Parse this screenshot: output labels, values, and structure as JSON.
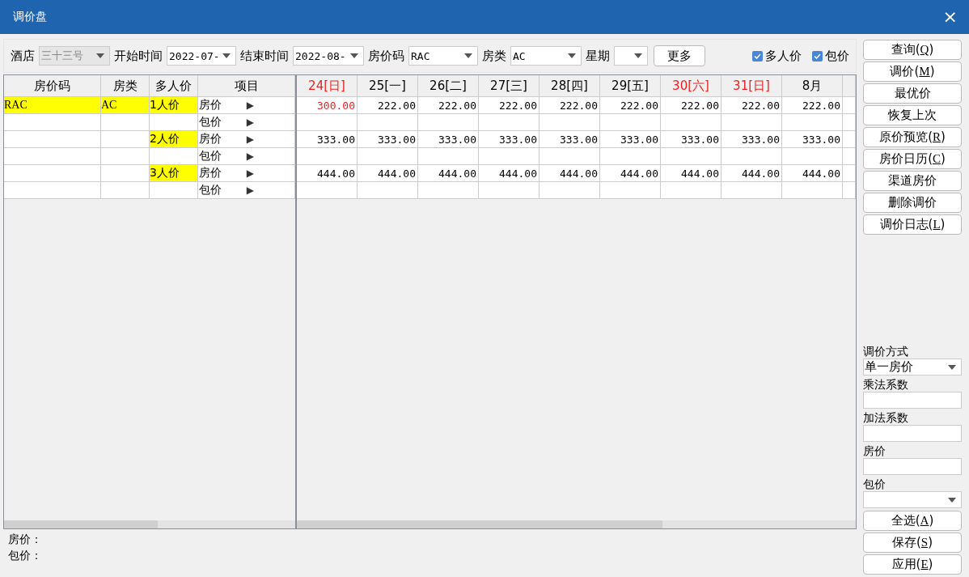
{
  "window": {
    "title": "调价盘",
    "close": "×"
  },
  "filters": [
    {
      "label": "酒店",
      "value": "三十三号",
      "disabled": true
    },
    {
      "label": "开始时间",
      "value": "2022-07-",
      "disabled": false
    },
    {
      "label": "结束时间",
      "value": "2022-08-",
      "disabled": false
    },
    {
      "label": "房价码",
      "value": "RAC",
      "disabled": false
    },
    {
      "label": "房类",
      "value": "AC",
      "disabled": false
    },
    {
      "label": "星期",
      "disabled": false
    }
  ],
  "more_button": "更多",
  "checkboxes": [
    {
      "label": "多人价",
      "checked": true
    },
    {
      "label": "包价",
      "checked": true
    }
  ],
  "left_table": {
    "columns": [
      "房价码",
      "房类",
      "多人价",
      "项目"
    ],
    "rows": [
      {
        "rate_code": "RAC",
        "room_type": "AC",
        "multi": "1人价",
        "item": "房价",
        "arrow": "▶"
      },
      {
        "item": "包价",
        "arrow": "▶"
      },
      {
        "multi": "2人价",
        "item": "房价",
        "arrow": "▶"
      },
      {
        "item": "包价",
        "arrow": "▶"
      },
      {
        "multi": "3人价",
        "item": "房价",
        "arrow": "▶"
      },
      {
        "item": "包价",
        "arrow": "▶"
      }
    ]
  },
  "date_table": {
    "columns": [
      {
        "label": "24[日]",
        "weekend": true
      },
      {
        "label": "25[一]",
        "weekend": false
      },
      {
        "label": "26[二]",
        "weekend": false
      },
      {
        "label": "27[三]",
        "weekend": false
      },
      {
        "label": "28[四]",
        "weekend": false
      },
      {
        "label": "29[五]",
        "weekend": false
      },
      {
        "label": "30[六]",
        "weekend": true
      },
      {
        "label": "31[日]",
        "weekend": true
      },
      {
        "label": "8月",
        "weekend": false
      }
    ],
    "rows": [
      {
        "cells": [
          {
            "value": "300.00",
            "modified": true
          },
          {
            "value": "222.00",
            "modified": false
          },
          {
            "value": "222.00",
            "modified": false
          },
          {
            "value": "222.00",
            "modified": false
          },
          {
            "value": "222.00",
            "modified": false
          },
          {
            "value": "222.00",
            "modified": false
          },
          {
            "value": "222.00",
            "modified": false
          },
          {
            "value": "222.00",
            "modified": false
          },
          {
            "value": "222.00",
            "modified": false
          }
        ]
      },
      {},
      {
        "cells": [
          {
            "value": "333.00",
            "modified": false
          },
          {
            "value": "333.00",
            "modified": false
          },
          {
            "value": "333.00",
            "modified": false
          },
          {
            "value": "333.00",
            "modified": false
          },
          {
            "value": "333.00",
            "modified": false
          },
          {
            "value": "333.00",
            "modified": false
          },
          {
            "value": "333.00",
            "modified": false
          },
          {
            "value": "333.00",
            "modified": false
          },
          {
            "value": "333.00",
            "modified": false
          }
        ]
      },
      {},
      {
        "cells": [
          {
            "value": "444.00",
            "modified": false
          },
          {
            "value": "444.00",
            "modified": false
          },
          {
            "value": "444.00",
            "modified": false
          },
          {
            "value": "444.00",
            "modified": false
          },
          {
            "value": "444.00",
            "modified": false
          },
          {
            "value": "444.00",
            "modified": false
          },
          {
            "value": "444.00",
            "modified": false
          },
          {
            "value": "444.00",
            "modified": false
          },
          {
            "value": "444.00",
            "modified": false
          }
        ]
      },
      {}
    ]
  },
  "footer": [
    "房价：",
    "包价："
  ],
  "actions": [
    {
      "label": "查询(",
      "mnemonic": "Q",
      "tail": ")"
    },
    {
      "label": "调价(",
      "mnemonic": "M",
      "tail": ")"
    },
    {
      "label": "最优价"
    },
    {
      "label": "恢复上次"
    },
    {
      "label": "原价预览(",
      "mnemonic": "R",
      "tail": ")"
    },
    {
      "label": "房价日历(",
      "mnemonic": "C",
      "tail": ")"
    },
    {
      "label": "渠道房价"
    },
    {
      "label": "删除调价"
    },
    {
      "label": "调价日志(",
      "mnemonic": "L",
      "tail": ")"
    }
  ],
  "adjust_form": [
    {
      "kind": "select",
      "label": "调价方式",
      "value": "单一房价"
    },
    {
      "kind": "input",
      "label": "乘法系数"
    },
    {
      "kind": "input",
      "label": "加法系数"
    },
    {
      "kind": "input",
      "label": "房价"
    },
    {
      "kind": "select",
      "label": "包价"
    }
  ],
  "bottom_actions": [
    {
      "label": "全选(",
      "mnemonic": "A",
      "tail": ")"
    },
    {
      "label": "保存(",
      "mnemonic": "S",
      "tail": ")"
    },
    {
      "label": "应用(",
      "mnemonic": "E",
      "tail": ")"
    }
  ]
}
